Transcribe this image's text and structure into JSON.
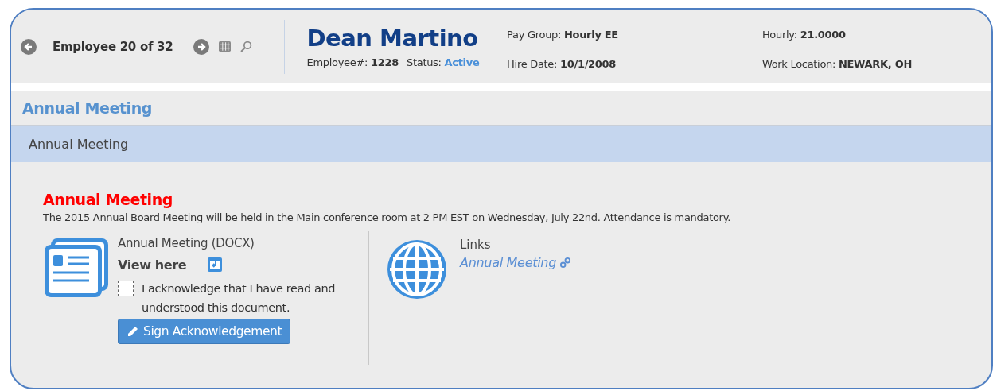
{
  "header": {
    "navigator": "Employee 20 of 32",
    "employee_name": "Dean Martino",
    "fields": [
      {
        "label": "Employee#:",
        "value": "1228",
        "kind": "plain"
      },
      {
        "label": "Status:",
        "value": "Active",
        "kind": "status"
      },
      {
        "label": "Pay Group:",
        "value": "Hourly EE",
        "kind": "plain"
      },
      {
        "label": "Hire Date:",
        "value": "10/1/2008",
        "kind": "plain"
      },
      {
        "label": "Hourly:",
        "value": "21.0000",
        "kind": "plain"
      },
      {
        "label": "Work Location:",
        "value": "NEWARK, OH",
        "kind": "plain"
      }
    ]
  },
  "page_title": "Annual Meeting",
  "section_title": "Annual Meeting",
  "announcement": {
    "title": "Annual Meeting",
    "body": "The 2015 Annual Board Meeting will be held in the Main conference room at 2 PM EST on Wednesday, July 22nd. Attendance is mandatory."
  },
  "document": {
    "name": "Annual Meeting (DOCX)",
    "view_link": "View here",
    "acknowledge": {
      "label": "I acknowledge that I have read and understood this document.",
      "checked": false
    },
    "sign_button": "Sign Acknowledgement"
  },
  "links": {
    "heading": "Links",
    "items": [
      "Annual Meeting"
    ]
  }
}
